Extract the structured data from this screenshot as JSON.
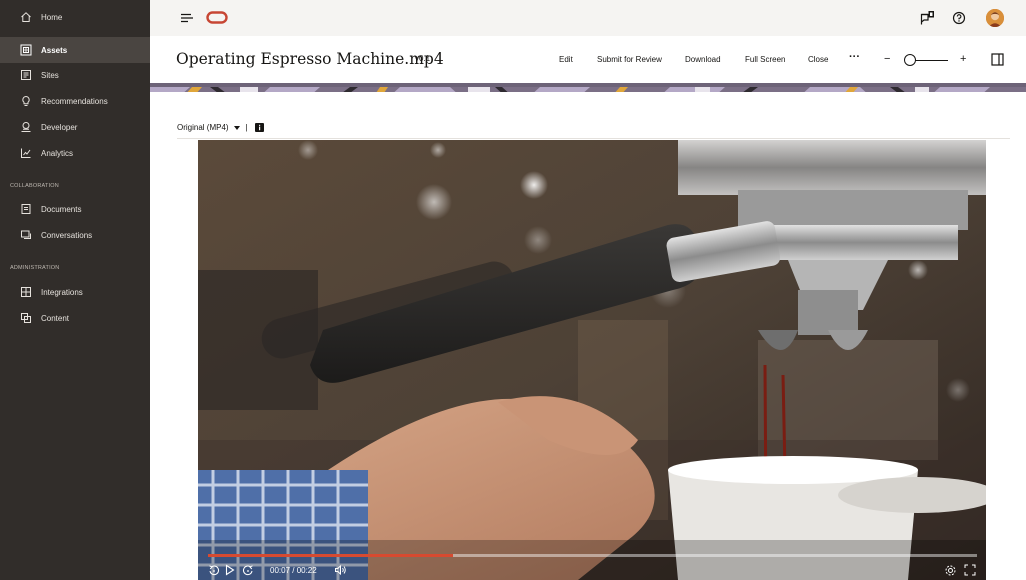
{
  "sidebar": {
    "items": [
      {
        "label": "Home",
        "icon": "home-icon"
      },
      {
        "label": "Assets",
        "icon": "assets-icon"
      },
      {
        "label": "Sites",
        "icon": "sites-icon"
      },
      {
        "label": "Recommendations",
        "icon": "lightbulb-icon"
      },
      {
        "label": "Developer",
        "icon": "developer-icon"
      },
      {
        "label": "Analytics",
        "icon": "analytics-icon"
      }
    ],
    "collaboration_heading": "COLLABORATION",
    "collaboration_items": [
      {
        "label": "Documents",
        "icon": "documents-icon"
      },
      {
        "label": "Conversations",
        "icon": "conversations-icon"
      }
    ],
    "administration_heading": "ADMINISTRATION",
    "administration_items": [
      {
        "label": "Integrations",
        "icon": "integrations-icon"
      },
      {
        "label": "Content",
        "icon": "content-icon"
      }
    ],
    "active": "Assets"
  },
  "topbar": {
    "icons": [
      "menu-icon",
      "oracle-logo",
      "notifications-icon",
      "help-icon",
      "avatar"
    ]
  },
  "header": {
    "title": "Operating Espresso Machine.mp4",
    "version": "v0.1",
    "actions": {
      "edit": "Edit",
      "submit": "Submit for Review",
      "download": "Download",
      "fullscreen": "Full Screen",
      "close": "Close",
      "more": "···"
    },
    "zoom_minus": "−",
    "zoom_plus": "+"
  },
  "content": {
    "rendition": "Original (MP4)",
    "separator": "|"
  },
  "player": {
    "time": "00:07 / 00:22",
    "progress": 0.318
  },
  "colors": {
    "sidebar_bg": "#312d2a",
    "accent": "#c74634",
    "progress": "#d74a30"
  }
}
